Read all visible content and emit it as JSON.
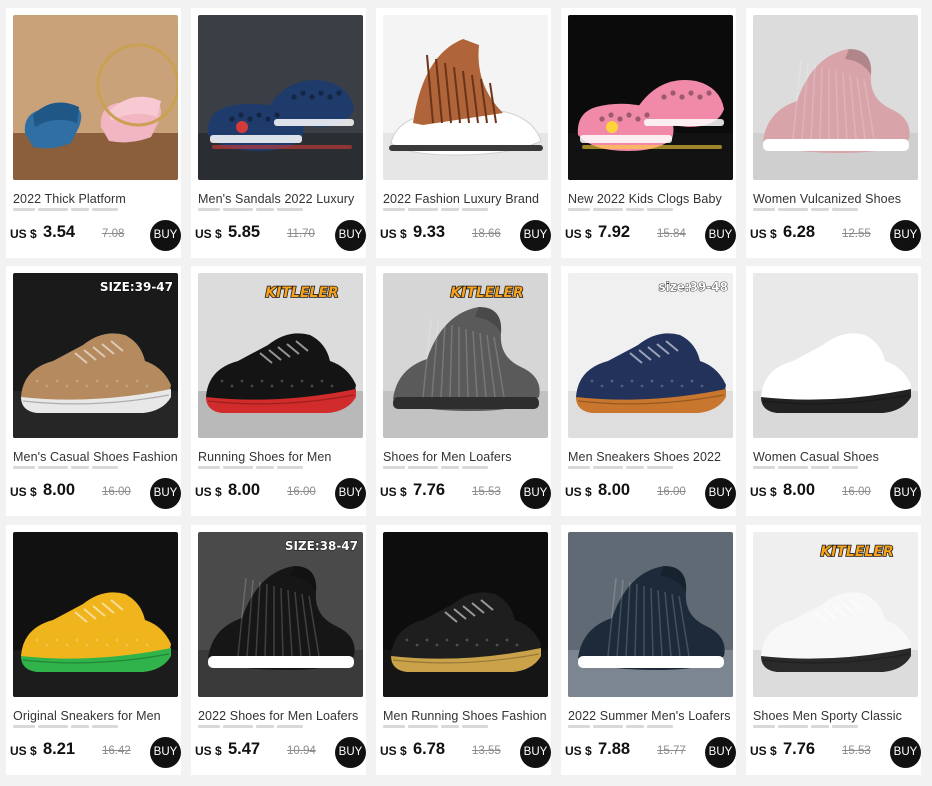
{
  "products": [
    {
      "title": "2022 Thick Platform",
      "currency": "US $",
      "price": "3.54",
      "old_price": "7.08",
      "buy_label": "BUY",
      "badge": "",
      "image": {
        "bg": "#c9a27a",
        "floor": "#8b5e3c",
        "shoe": "#2f6fa3",
        "shoe2": "#f2b6c2",
        "type": "slide"
      }
    },
    {
      "title": "Men's Sandals 2022 Luxury",
      "currency": "US $",
      "price": "5.85",
      "old_price": "11.70",
      "buy_label": "BUY",
      "badge": "",
      "image": {
        "bg": "#3b3f45",
        "floor": "#2a2d31",
        "shoe": "#1f3b6b",
        "shoe2": "#d33b3b",
        "type": "clog"
      }
    },
    {
      "title": "2022 Fashion Luxury Brand",
      "currency": "US $",
      "price": "9.33",
      "old_price": "18.66",
      "buy_label": "BUY",
      "badge": "",
      "image": {
        "bg": "#f4f4f4",
        "floor": "#e6e6e6",
        "shoe": "#b0643a",
        "shoe2": "#ffffff",
        "type": "sandal"
      }
    },
    {
      "title": "New 2022 Kids Clogs Baby",
      "currency": "US $",
      "price": "7.92",
      "old_price": "15.84",
      "buy_label": "BUY",
      "badge": "",
      "image": {
        "bg": "#0b0b0b",
        "floor": "#121212",
        "shoe": "#f08aa8",
        "shoe2": "#ffd33b",
        "type": "clog"
      }
    },
    {
      "title": "Women Vulcanized Shoes",
      "currency": "US $",
      "price": "6.28",
      "old_price": "12.55",
      "buy_label": "BUY",
      "badge": "",
      "image": {
        "bg": "#dcdcdc",
        "floor": "#cfcfcf",
        "shoe": "#d8a4aa",
        "shoe2": "#ffffff",
        "type": "sock"
      }
    },
    {
      "title": "Men's Casual Shoes Fashion",
      "currency": "US $",
      "price": "8.00",
      "old_price": "16.00",
      "buy_label": "BUY",
      "badge": "SIZE:39-47",
      "image": {
        "bg": "#1a1a1a",
        "floor": "#262626",
        "shoe": "#b58a5f",
        "shoe2": "#e8e8e8",
        "type": "sneaker"
      }
    },
    {
      "title": "Running Shoes for Men",
      "currency": "US $",
      "price": "8.00",
      "old_price": "16.00",
      "buy_label": "BUY",
      "badge": "KITLELER",
      "image": {
        "bg": "#dcdcdc",
        "floor": "#b9b9b9",
        "shoe": "#141414",
        "shoe2": "#d12b2b",
        "type": "sneaker"
      }
    },
    {
      "title": "Shoes for Men Loafers",
      "currency": "US $",
      "price": "7.76",
      "old_price": "15.53",
      "buy_label": "BUY",
      "badge": "KITLELER",
      "image": {
        "bg": "#d6d6d6",
        "floor": "#c2c2c2",
        "shoe": "#5a5a5a",
        "shoe2": "#2e2e2e",
        "type": "sock"
      }
    },
    {
      "title": "Men Sneakers Shoes 2022",
      "currency": "US $",
      "price": "8.00",
      "old_price": "16.00",
      "buy_label": "BUY",
      "badge": "size:39-48",
      "image": {
        "bg": "#f0f0f0",
        "floor": "#dedede",
        "shoe": "#22325a",
        "shoe2": "#c9772e",
        "type": "sneaker"
      }
    },
    {
      "title": "Women Casual Shoes",
      "currency": "US $",
      "price": "8.00",
      "old_price": "16.00",
      "buy_label": "BUY",
      "badge": "",
      "image": {
        "bg": "#e9e9e9",
        "floor": "#d9d9d9",
        "shoe": "#ffffff",
        "shoe2": "#222222",
        "type": "sneaker"
      }
    },
    {
      "title": "Original Sneakers for Men",
      "currency": "US $",
      "price": "8.21",
      "old_price": "16.42",
      "buy_label": "BUY",
      "badge": "",
      "image": {
        "bg": "#111111",
        "floor": "#1c1c1c",
        "shoe": "#f0b41c",
        "shoe2": "#2fb34a",
        "type": "sneaker"
      }
    },
    {
      "title": "2022 Shoes for Men Loafers",
      "currency": "US $",
      "price": "5.47",
      "old_price": "10.94",
      "buy_label": "BUY",
      "badge": "SIZE:38-47",
      "image": {
        "bg": "#4a4a4a",
        "floor": "#3a3a3a",
        "shoe": "#161616",
        "shoe2": "#ffffff",
        "type": "sock"
      }
    },
    {
      "title": "Men Running Shoes Fashion",
      "currency": "US $",
      "price": "6.78",
      "old_price": "13.55",
      "buy_label": "BUY",
      "badge": "",
      "image": {
        "bg": "#0d0d0d",
        "floor": "#151515",
        "shoe": "#1e1e1e",
        "shoe2": "#c9a24a",
        "type": "sneaker"
      }
    },
    {
      "title": "2022 Summer Men's Loafers",
      "currency": "US $",
      "price": "7.88",
      "old_price": "15.77",
      "buy_label": "BUY",
      "badge": "",
      "image": {
        "bg": "#5f6a74",
        "floor": "#7c8690",
        "shoe": "#1d2a3a",
        "shoe2": "#ffffff",
        "type": "sock"
      }
    },
    {
      "title": "Shoes Men Sporty Classic",
      "currency": "US $",
      "price": "7.76",
      "old_price": "15.53",
      "buy_label": "BUY",
      "badge": "KITLELER",
      "image": {
        "bg": "#efefef",
        "floor": "#dcdcdc",
        "shoe": "#f8f8f8",
        "shoe2": "#2a2a2a",
        "type": "sneaker"
      }
    }
  ]
}
